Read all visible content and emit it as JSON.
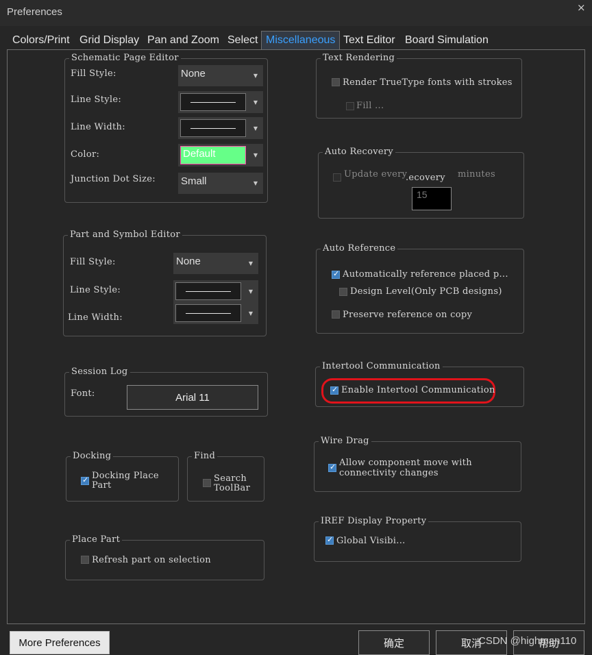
{
  "window": {
    "title": "Preferences",
    "close_glyph": "×"
  },
  "tabs": [
    {
      "label": "Colors/Print"
    },
    {
      "label": "Grid Display"
    },
    {
      "label": "Pan and Zoom"
    },
    {
      "label": "Select"
    },
    {
      "label": "Miscellaneous",
      "active": true
    },
    {
      "label": "Text Editor"
    },
    {
      "label": "Board Simulation"
    }
  ],
  "schematic_page_editor": {
    "title": "Schematic Page Editor",
    "fill_style_label": "Fill Style:",
    "fill_style_value": "None",
    "line_style_label": "Line Style:",
    "line_width_label": "Line Width:",
    "color_label": "Color:",
    "color_value": "Default",
    "color_swatch": "#66ff88",
    "junction_label": "Junction Dot Size:",
    "junction_value": "Small"
  },
  "part_symbol_editor": {
    "title": "Part and Symbol Editor",
    "fill_style_label": "Fill Style:",
    "fill_style_value": "None",
    "line_style_label": "Line Style:",
    "line_width_label": "Line Width:"
  },
  "session_log": {
    "title": "Session Log",
    "font_label": "Font:",
    "font_value": "Arial 11"
  },
  "docking": {
    "title": "Docking",
    "checkbox_label_1": "Docking Place",
    "checkbox_label_2": "Part",
    "checked": true
  },
  "find": {
    "title": "Find",
    "checkbox_label_1": "Search",
    "checkbox_label_2": "ToolBar",
    "checked": false
  },
  "place_part": {
    "title": "Place Part",
    "checkbox_label": "Refresh part on selection",
    "checked": false
  },
  "text_rendering": {
    "title": "Text Rendering",
    "truetype_label": "Render TrueType fonts with strokes",
    "fill_label": "Fill ..."
  },
  "auto_recovery": {
    "title": "Auto Recovery",
    "update_label": "Update every",
    "overlap_text": ".ecovery",
    "minutes_label": "minutes",
    "minutes_value": "15"
  },
  "auto_reference": {
    "title": "Auto Reference",
    "auto_ref_label": "Automatically reference placed p...",
    "design_level_label": "Design Level(Only PCB designs)",
    "preserve_label": "Preserve reference on copy"
  },
  "intertool": {
    "title": "Intertool Communication",
    "enable_label": "Enable Intertool Communication",
    "highlight_color": "#e0131b"
  },
  "wire_drag": {
    "title": "Wire Drag",
    "label_1": "Allow component move with",
    "label_2": "connectivity changes"
  },
  "iref": {
    "title": "IREF Display Property",
    "label": "Global Visibi..."
  },
  "buttons": {
    "more": "More Preferences",
    "ok": "确定",
    "cancel": "取消",
    "help": "帮助"
  },
  "watermark": "CSDN @highman110"
}
